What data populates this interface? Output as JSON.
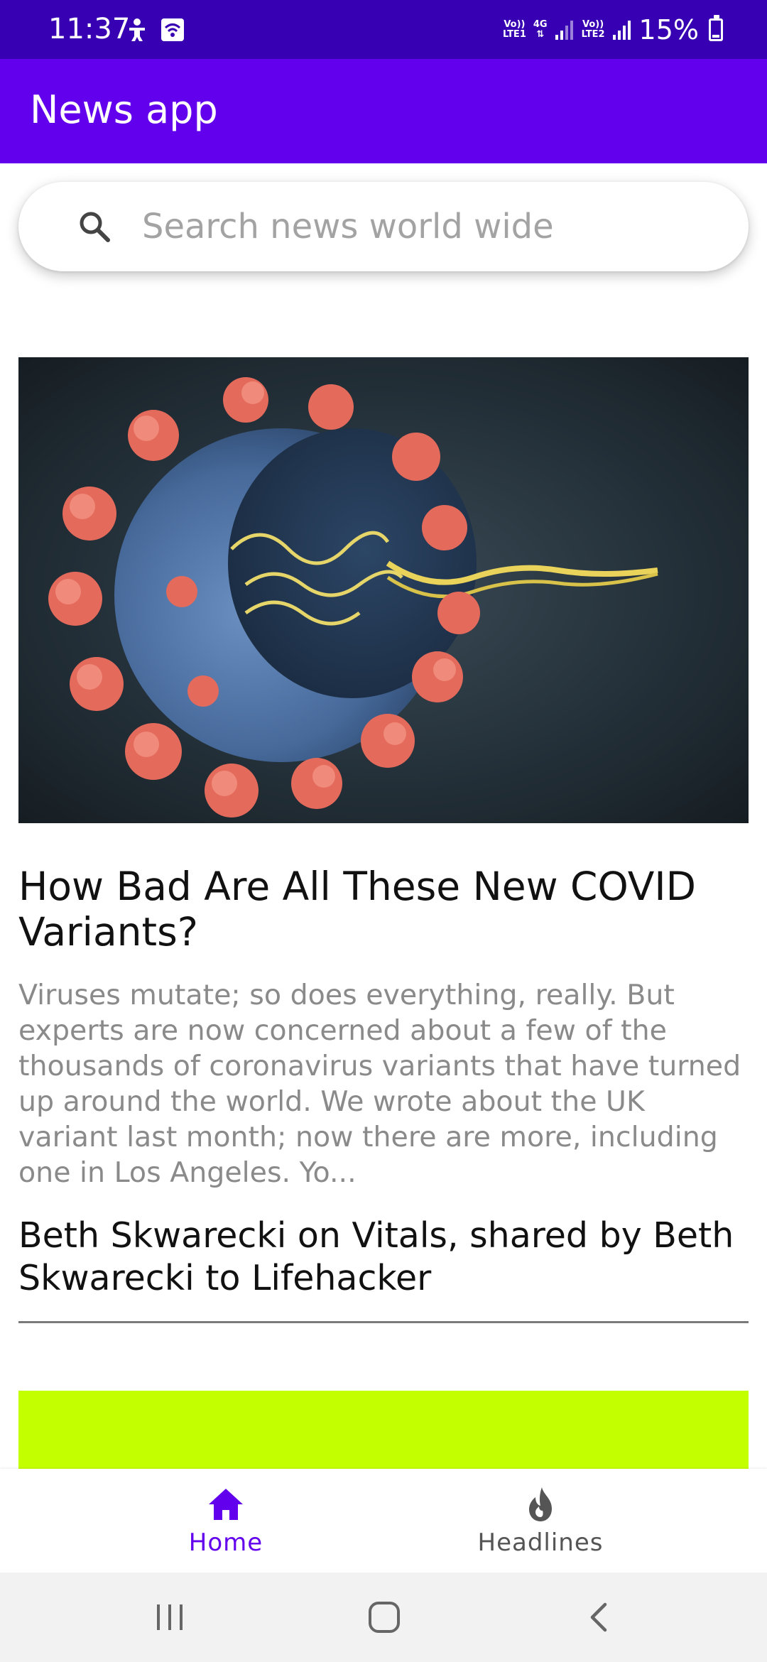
{
  "status_bar": {
    "time": "11:37",
    "sim1_label_top": "Vo))",
    "sim1_label_bottom": "LTE1",
    "network_type": "4G",
    "sim2_label_top": "Vo))",
    "sim2_label_bottom": "LTE2",
    "battery": "15%",
    "battery_level": 0.15
  },
  "app_bar": {
    "title": "News app"
  },
  "search": {
    "placeholder": "Search news world wide",
    "value": ""
  },
  "articles": [
    {
      "title": "How Bad Are All These New COVID Variants?",
      "description": "Viruses mutate; so does everything, really. But experts are now concerned about a few of the thousands of coronavirus variants that have turned up around the world. We wrote about the UK variant last month; now there are more, including one in Los Angeles. Yo...",
      "source": "Beth Skwarecki on Vitals, shared by Beth Skwarecki to Lifehacker"
    }
  ],
  "bottom_nav": {
    "items": [
      {
        "label": "Home",
        "icon": "home-icon",
        "selected": true
      },
      {
        "label": "Headlines",
        "icon": "fire-icon",
        "selected": false
      }
    ]
  },
  "system_nav": {
    "recents": "recents-icon",
    "home": "home-button-icon",
    "back": "back-icon"
  },
  "colors": {
    "status_bar": "#3700b3",
    "app_bar": "#6200ee",
    "accent": "#6200ee",
    "inactive": "#555555",
    "next_card": "#c4ff00"
  }
}
